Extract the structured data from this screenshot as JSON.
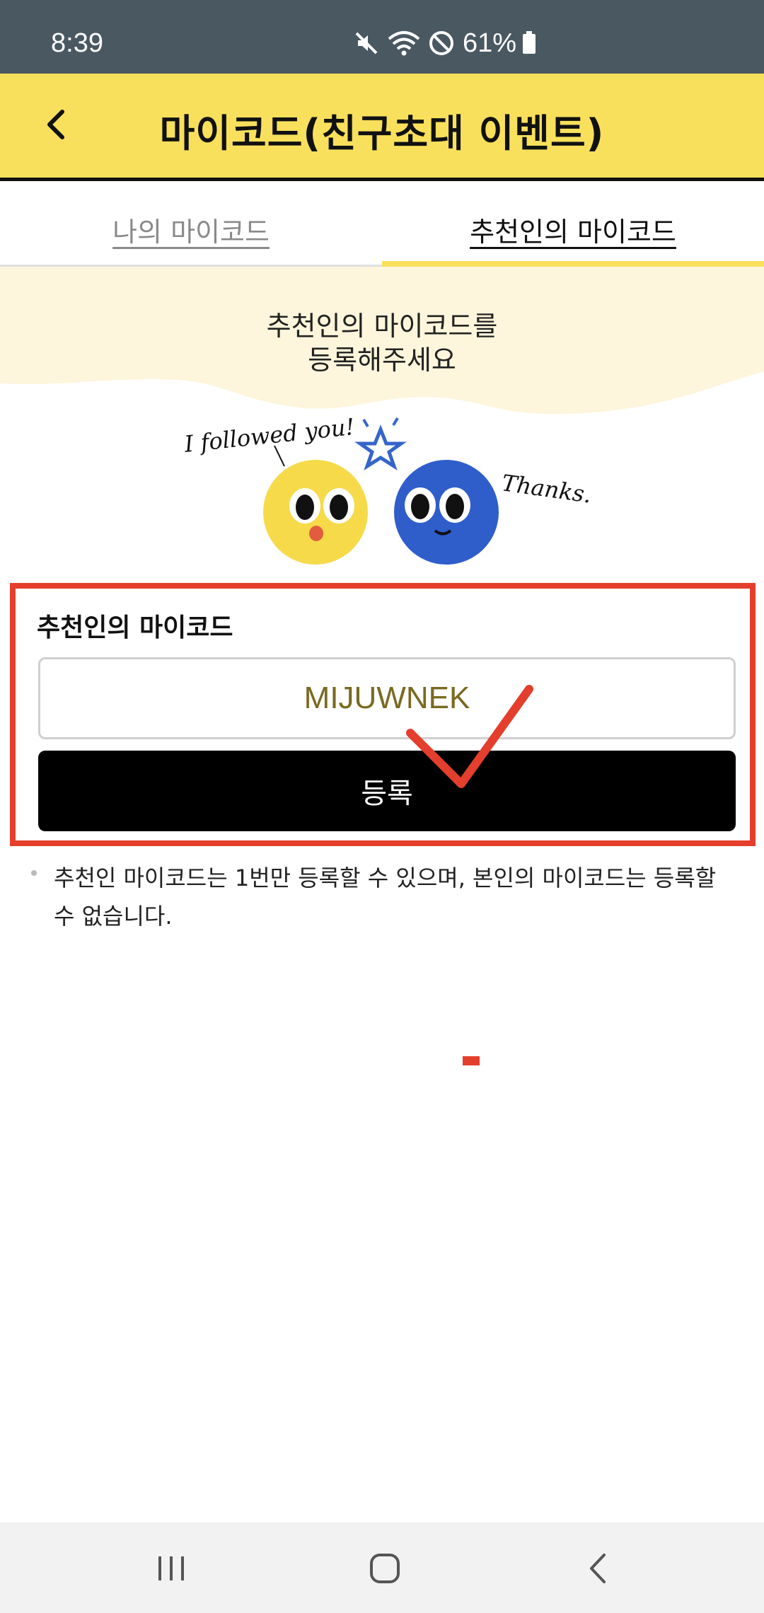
{
  "status_bar": {
    "time": "8:39",
    "battery": "61%"
  },
  "header": {
    "title": "마이코드(친구초대 이벤트)"
  },
  "tabs": [
    {
      "label": "나의 마이코드",
      "selected": false
    },
    {
      "label": "추천인의 마이코드",
      "selected": true
    }
  ],
  "hero": {
    "instruction_line1": "추천인의 마이코드를",
    "instruction_line2": "등록해주세요",
    "speech_left": "I followed you!",
    "speech_right": "Thanks."
  },
  "form": {
    "label": "추천인의 마이코드",
    "code_value": "MIJUWNEK",
    "register_label": "등록"
  },
  "note": {
    "text": "추천인 마이코드는 1번만 등록할 수 있으며, 본인의 마이코드는 등록할 수 없습니다."
  },
  "colors": {
    "accent_yellow": "#f8e05c",
    "annotation_red": "#e43f2c",
    "status_bar": "#4a5862"
  }
}
